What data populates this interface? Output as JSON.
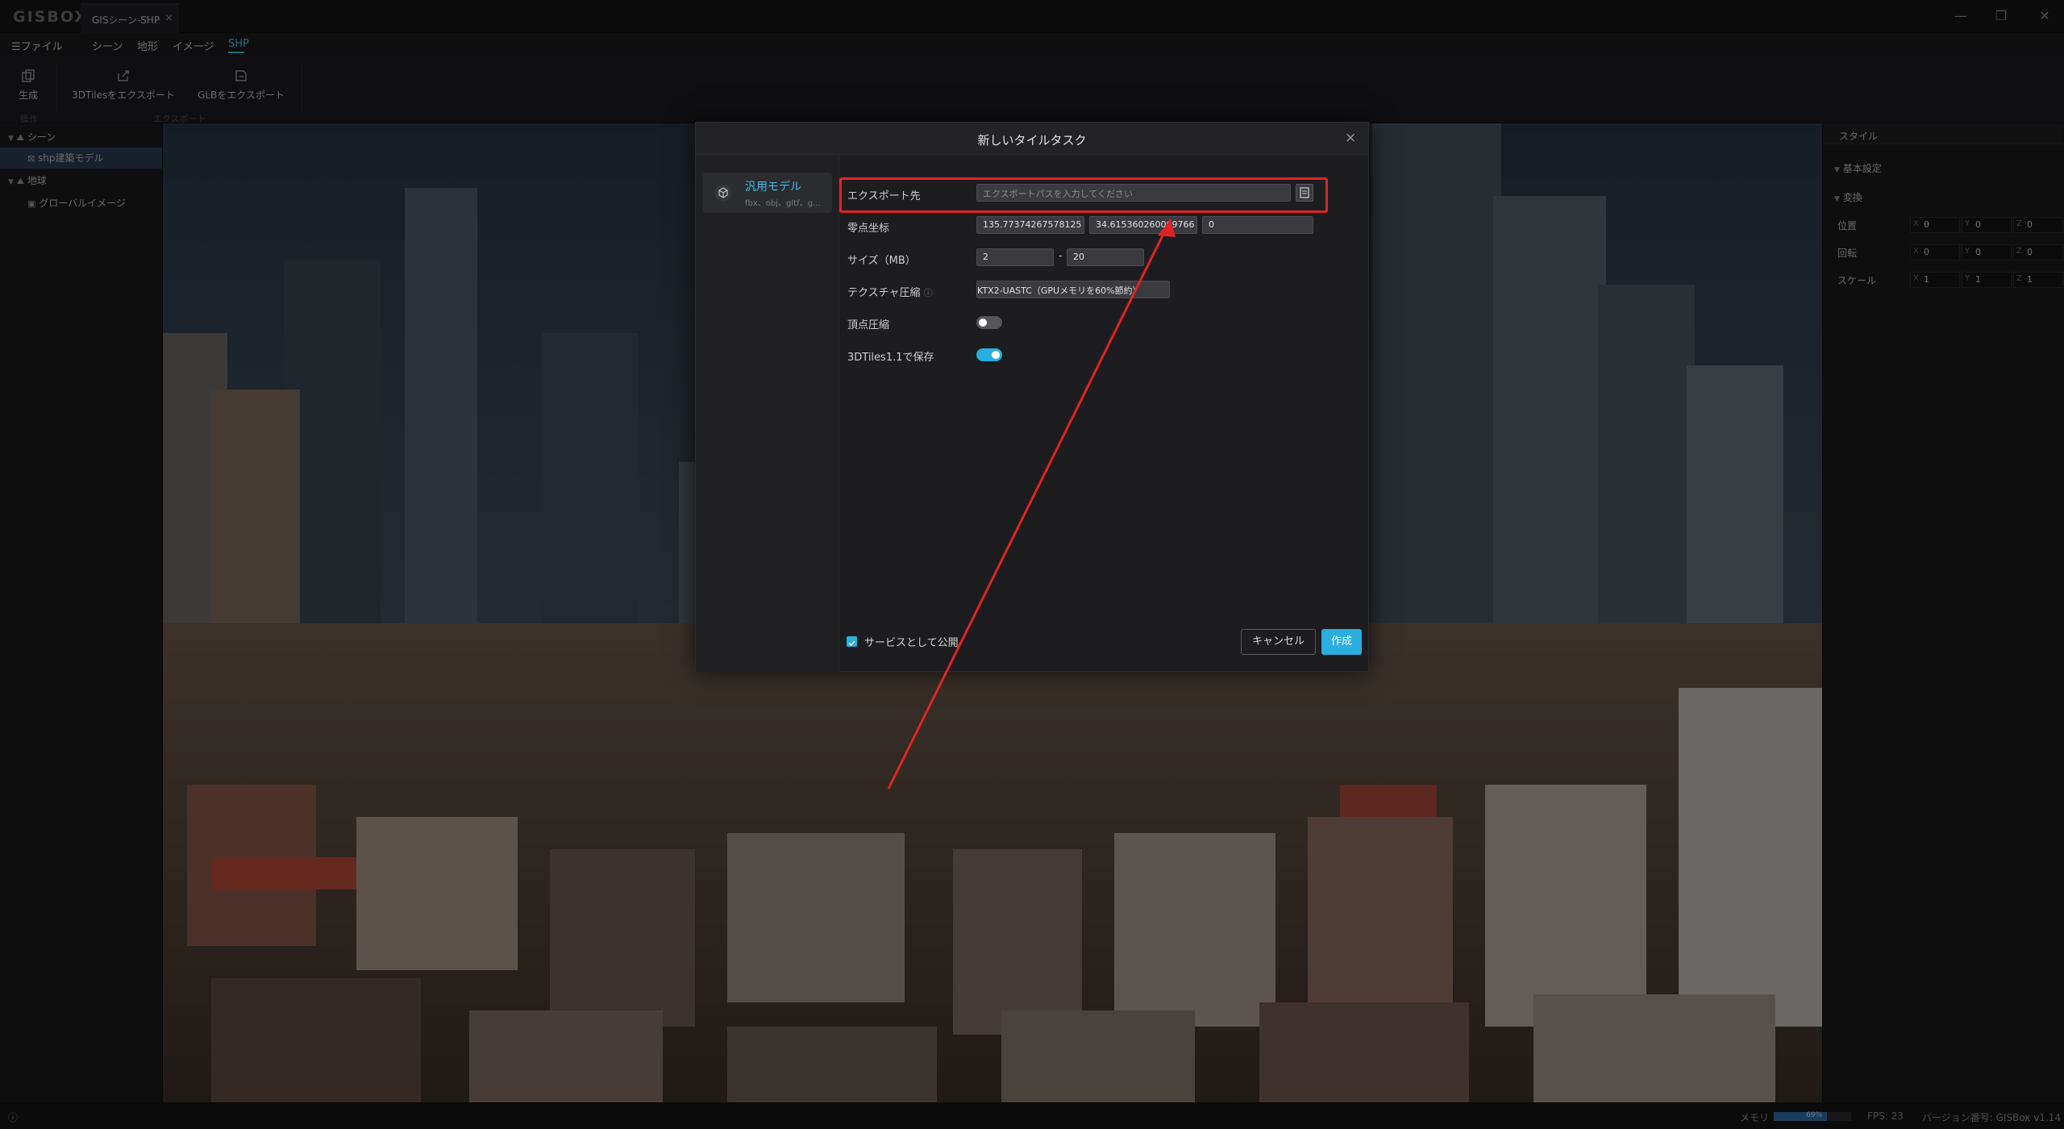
{
  "app": {
    "logo": "GISBOX",
    "doc_tab": "GISシーン-SHP",
    "doc_tab_close": "×"
  },
  "window_controls": {
    "minimize": "—",
    "restore": "❐",
    "close": "✕"
  },
  "menu": {
    "file": "☰ファイル",
    "scene": "シーン",
    "terrain": "地形",
    "image": "イメージ",
    "shp": "SHP"
  },
  "ribbon": {
    "generate": "生成",
    "export_3dtiles": "3DTilesをエクスポート",
    "export_glb": "GLBをエクスポート",
    "group_operation": "操作",
    "group_export": "エクスポート"
  },
  "scene_tree": {
    "scene": "シーン",
    "shp_model": "shp建築モデル",
    "earth": "地球",
    "global_image": "グローバルイメージ"
  },
  "right_panel": {
    "tab_style": "スタイル",
    "section_basic": "基本設定",
    "section_transform": "変換",
    "position": "位置",
    "rotation": "回転",
    "scale": "スケール",
    "axis_x": "X",
    "axis_y": "Y",
    "axis_z": "Z",
    "position_values": [
      "0",
      "0",
      "0"
    ],
    "rotation_values": [
      "0",
      "0",
      "0"
    ],
    "scale_values": [
      "1",
      "1",
      "1"
    ]
  },
  "status": {
    "memory_label": "メモリ",
    "memory_percent": "69%",
    "memory_fraction": 0.69,
    "fps": "FPS: 23",
    "version": "バージョン番号: GISBox v1.14"
  },
  "dialog": {
    "title": "新しいタイルタスク",
    "close": "×",
    "model_type": "汎用モデル",
    "model_formats": "fbx、obj、gltf、g...",
    "export_label": "エクスポート先",
    "export_placeholder": "エクスポートパスを入力してください",
    "origin_label": "零点坐标",
    "origin_lon": "135.77374267578125",
    "origin_lat": "34.615360260009766",
    "origin_height": "0",
    "size_label": "サイズ（MB）",
    "size_min": "2",
    "size_sep": "-",
    "size_max": "20",
    "texture_label": "テクスチャ圧縮",
    "texture_value": "KTX2-UASTC（GPUメモリを60%節約）",
    "vertex_label": "頂点圧縮",
    "vertex_on": false,
    "save_label": "3DTiles1.1で保存",
    "save_on": true,
    "publish_label": "サービスとして公開",
    "publish_checked": true,
    "cancel": "キャンセル",
    "create": "作成"
  },
  "colors": {
    "accent": "#2aaee0",
    "highlight_red": "#e02424"
  }
}
